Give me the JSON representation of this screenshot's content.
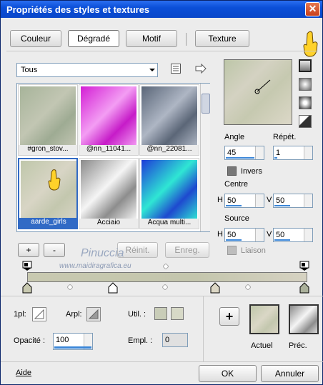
{
  "window": {
    "title": "Propriétés des styles et textures",
    "close_glyph": "✕"
  },
  "tabs": [
    {
      "label": "Couleur"
    },
    {
      "label": "Dégradé"
    },
    {
      "label": "Motif"
    },
    {
      "label": "Texture"
    }
  ],
  "filter": {
    "value": "Tous"
  },
  "gradients": [
    {
      "label": "#gron_stov...",
      "colors": [
        "#a7b49a",
        "#c2c6b3",
        "#9eab93"
      ]
    },
    {
      "label": "@nn_11041...",
      "colors": [
        "#d31fd4",
        "#f39df3",
        "#c61bc8"
      ]
    },
    {
      "label": "@nn_22081...",
      "colors": [
        "#5a6678",
        "#aeb6c4",
        "#5b6677"
      ]
    },
    {
      "label": "aarde_girls",
      "colors": [
        "#bfc7aa",
        "#d8d5c5",
        "#c3c7ae"
      ]
    },
    {
      "label": "Acciaio",
      "colors": [
        "#8a8a8a",
        "#f5f5f5",
        "#8d8d8d"
      ]
    },
    {
      "label": "Acqua multi...",
      "colors": [
        "#1d3bd8",
        "#2fe6d4",
        "#1e49cf"
      ]
    }
  ],
  "buttons": {
    "add": "+",
    "remove": "-",
    "reset": "Réinit.",
    "save": "Enreg.",
    "ok": "OK",
    "cancel": "Annuler",
    "help": "Aide",
    "add_swatch": "+"
  },
  "angle": {
    "label": "Angle",
    "value": "45"
  },
  "repeat": {
    "label": "Répét.",
    "value": "1"
  },
  "invert": {
    "label": "Invers"
  },
  "center": {
    "label": "Centre",
    "h_label": "H",
    "h_value": "50",
    "v_label": "V",
    "v_value": "50"
  },
  "source": {
    "label": "Source",
    "h_label": "H",
    "h_value": "50",
    "v_label": "V",
    "v_value": "50"
  },
  "link": {
    "label": "Liaison"
  },
  "watermark": {
    "line1": "Pinuccia",
    "line2": "www.maidiragrafica.eu"
  },
  "lower": {
    "first_label": "1pl:",
    "arpl_label": "Arpl:",
    "util_label": "Util. :",
    "opacity_label": "Opacité :",
    "opacity_value": "100",
    "empl_label": "Empl. :",
    "empl_value": "0",
    "current_label": "Actuel",
    "previous_label": "Préc."
  },
  "colors": {
    "accent": "#316ac5",
    "titlebar": "#0b4fd8"
  }
}
